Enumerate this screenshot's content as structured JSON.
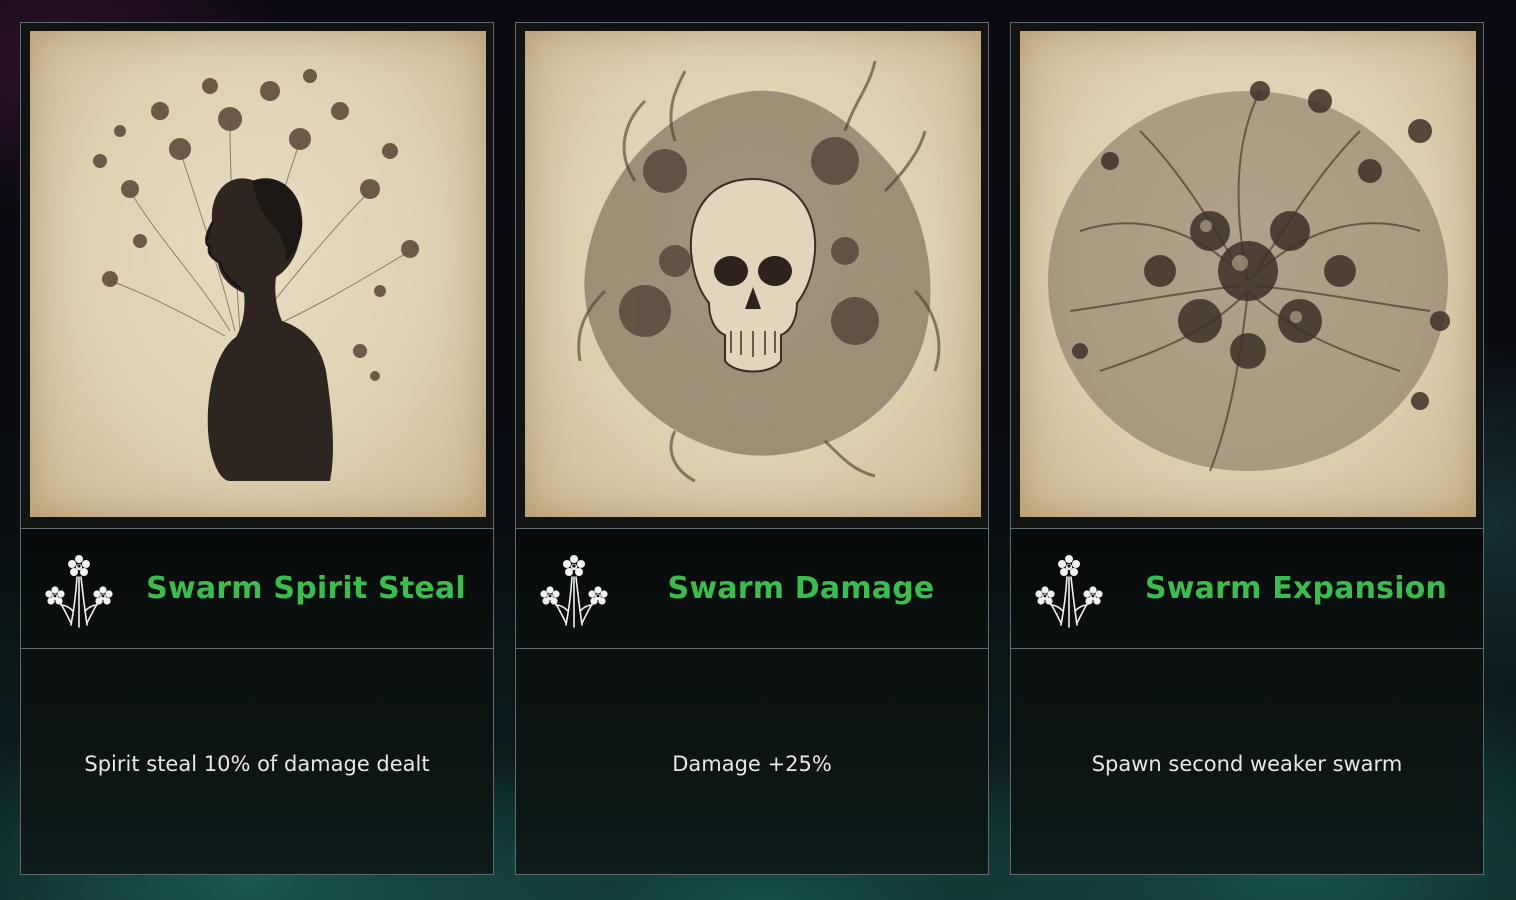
{
  "cards": [
    {
      "title": "Swarm Spirit Steal",
      "description": "Spirit steal 10% of damage dealt",
      "icon": "flower-bouquet-icon",
      "illustration": "woman-with-flowers-illustration"
    },
    {
      "title": "Swarm Damage",
      "description": "Damage +25%",
      "icon": "flower-bouquet-icon",
      "illustration": "skull-in-smoke-illustration"
    },
    {
      "title": "Swarm Expansion",
      "description": "Spawn second weaker swarm",
      "icon": "flower-bouquet-icon",
      "illustration": "flower-swarm-illustration"
    }
  ],
  "colors": {
    "title": "#3bbd4e",
    "description": "#e8e8e8",
    "card_border": "#5f6b6e",
    "card_background": "#0b1211",
    "parchment": "#dfd0b1"
  }
}
